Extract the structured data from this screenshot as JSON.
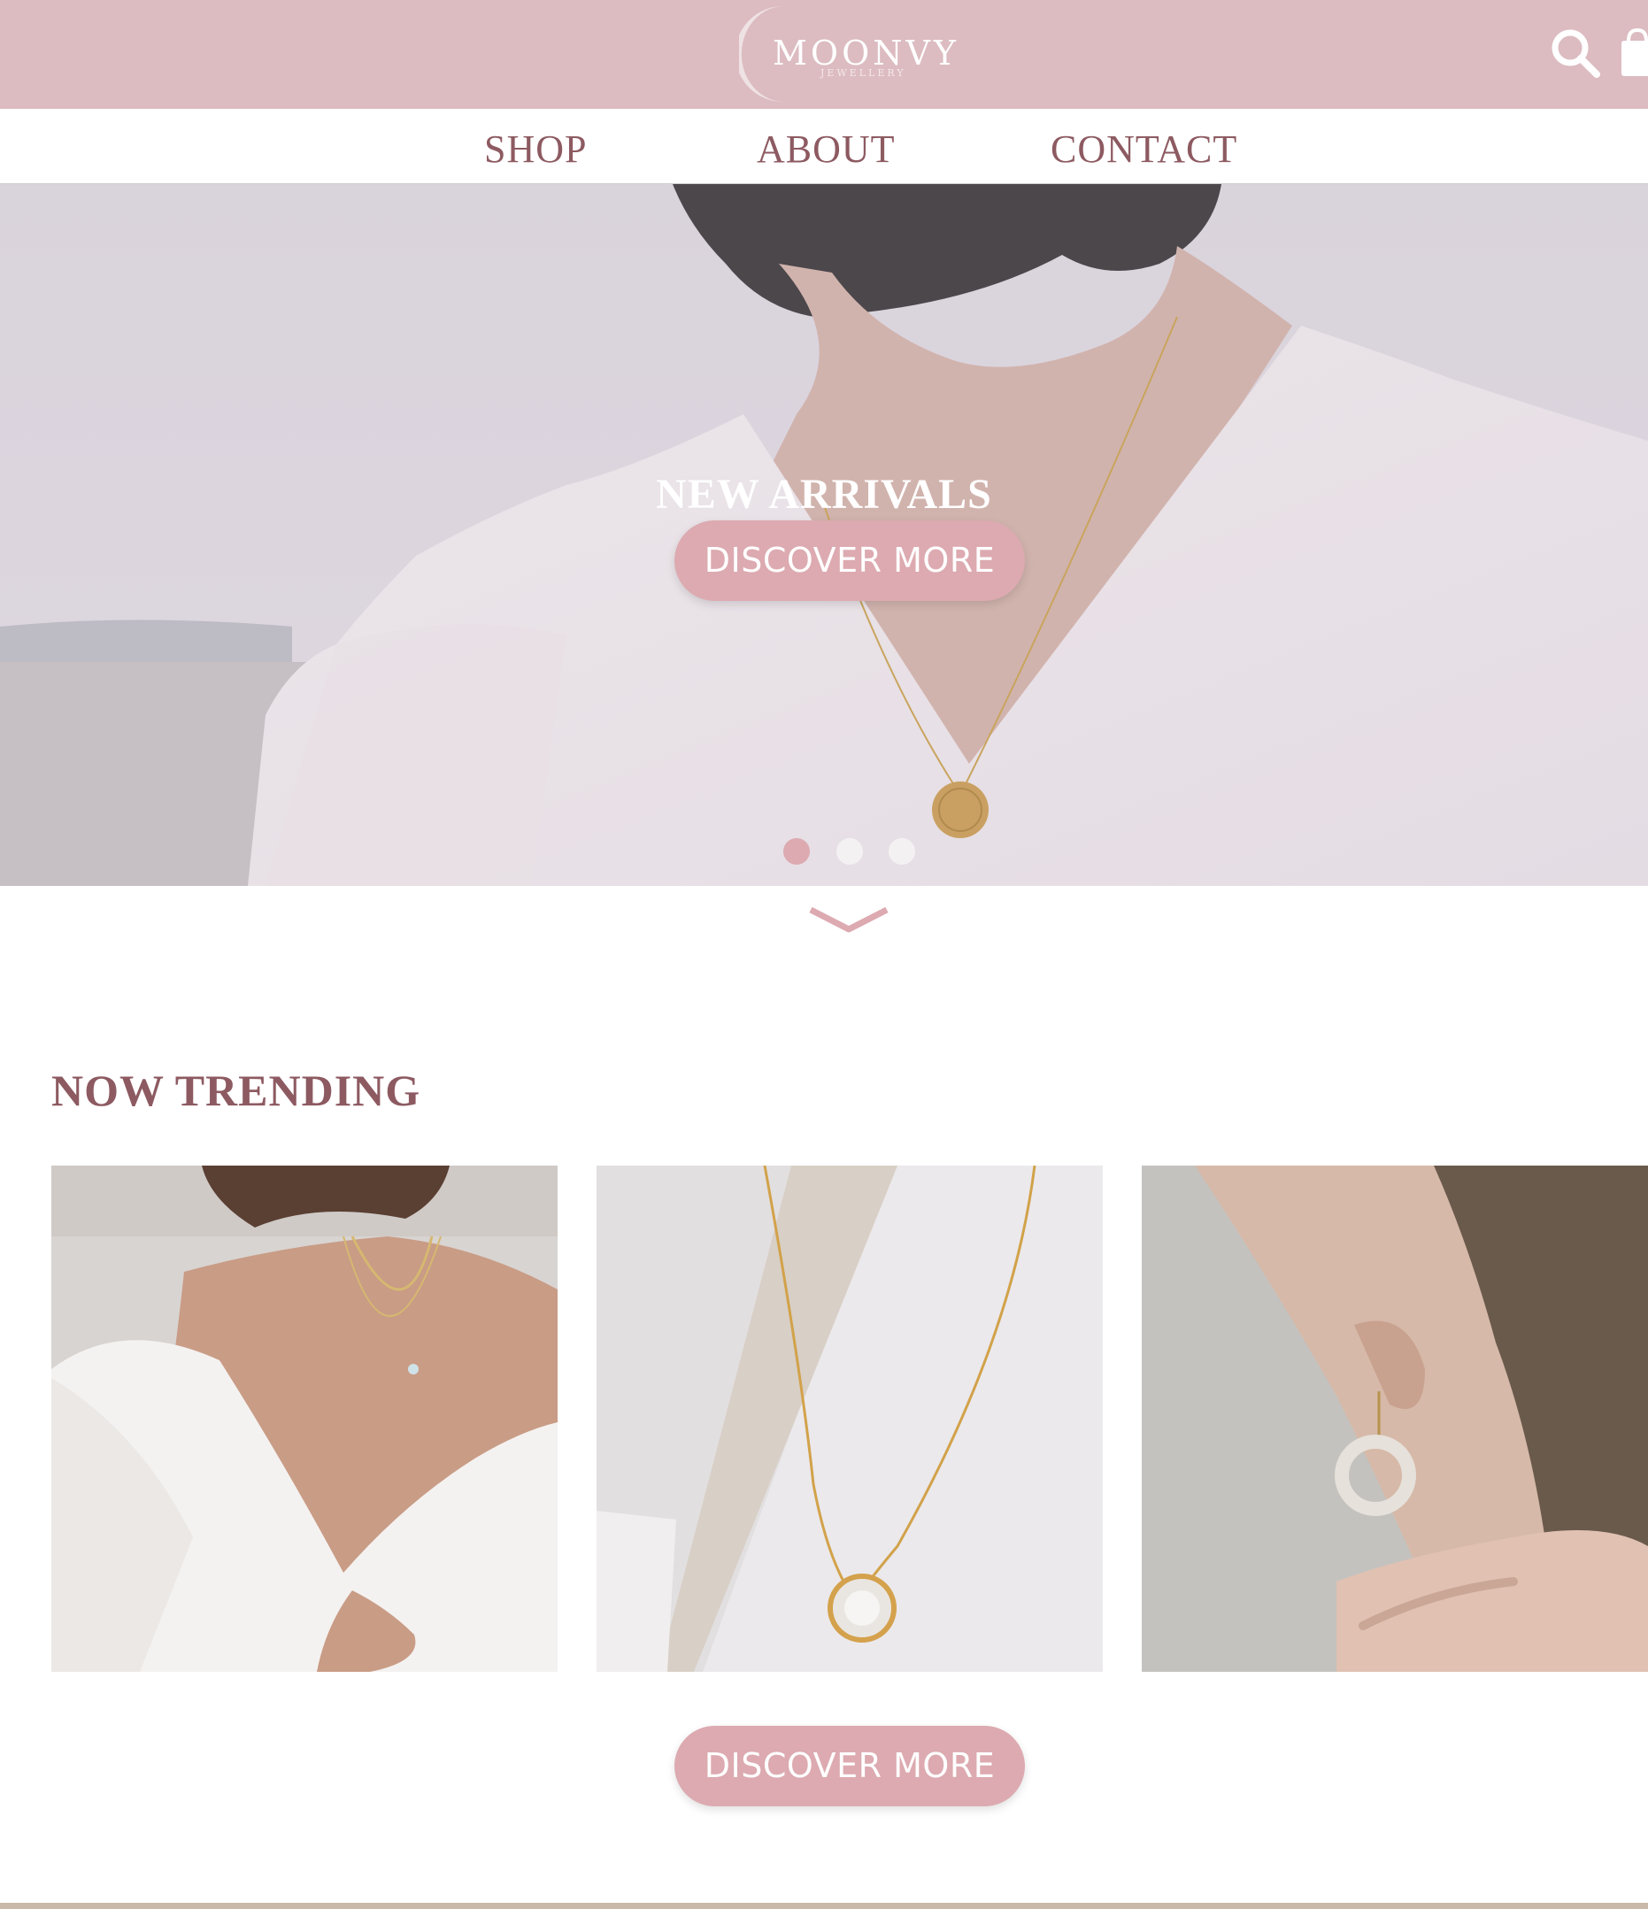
{
  "brand": {
    "name": "MOONVY",
    "tagline": "JEWELLERY"
  },
  "header": {
    "icons": [
      "search-icon",
      "shopping-bag-icon"
    ]
  },
  "nav": {
    "items": [
      {
        "label": "SHOP"
      },
      {
        "label": "ABOUT"
      },
      {
        "label": "CONTACT"
      }
    ]
  },
  "hero": {
    "title": "NEW ARRIVALS",
    "button_label": "DISCOVER MORE",
    "slides": {
      "count": 3,
      "active": 1
    }
  },
  "trending": {
    "title": "NOW TRENDING",
    "products": [
      {
        "image": "layered-gold-necklaces-photo"
      },
      {
        "image": "crystal-pendant-necklace-photo"
      },
      {
        "image": "hoop-earring-photo"
      }
    ],
    "button_label": "DISCOVER MORE"
  },
  "colors": {
    "header_bg": "#dcbcc1",
    "accent": "#dcaab0",
    "text_brand": "#8d5a61"
  }
}
